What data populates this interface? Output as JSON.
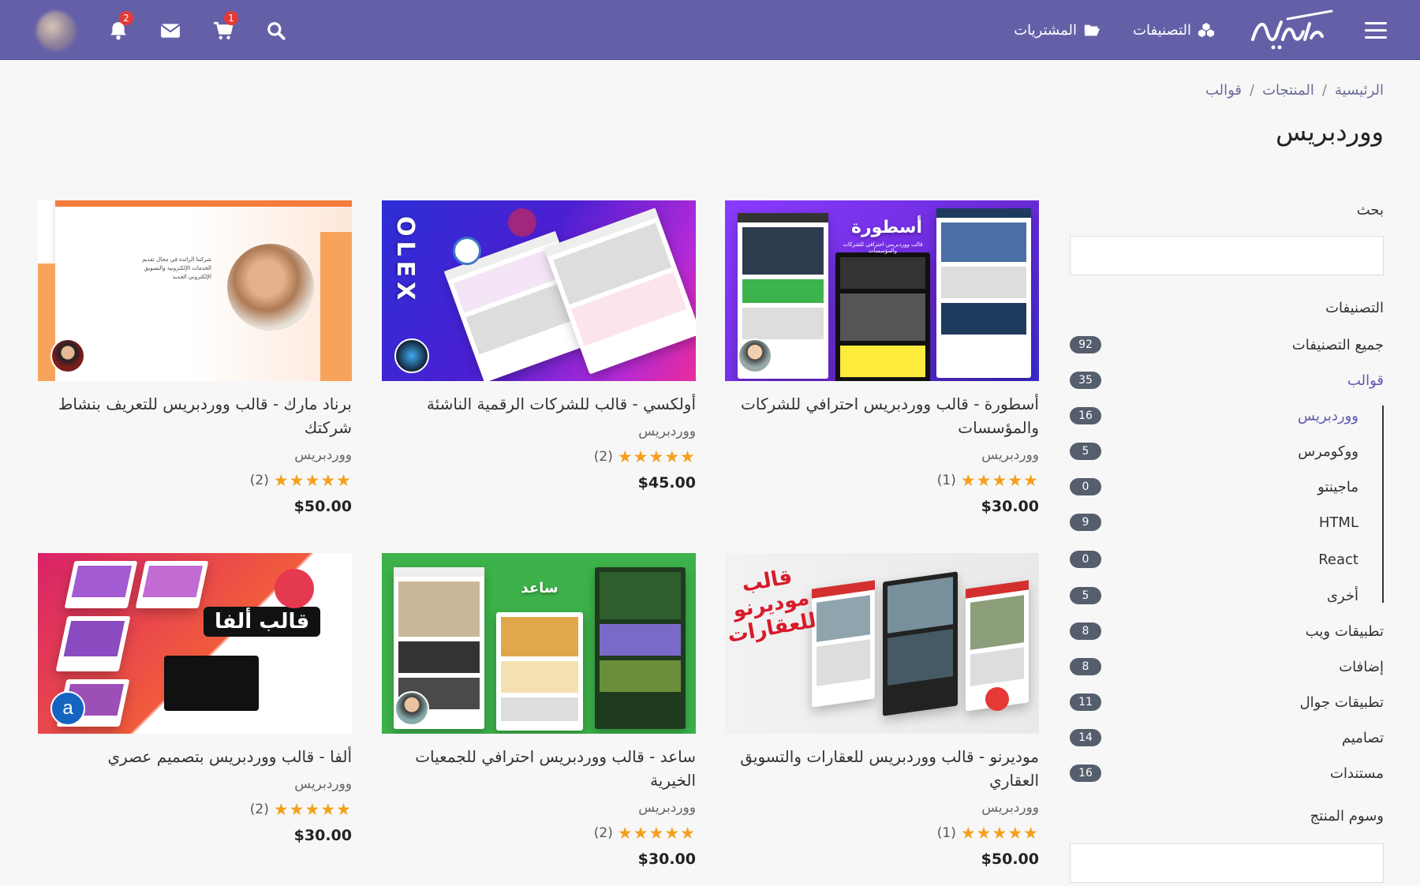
{
  "header": {
    "menu_icon": "hamburger-icon",
    "logo_icon": "brand-logo",
    "nav": [
      {
        "label": "التصنيفات",
        "icon": "cubes-icon"
      },
      {
        "label": "المشتريات",
        "icon": "folder-open-icon"
      }
    ],
    "cart_badge": "1",
    "bell_badge": "2"
  },
  "breadcrumb": [
    "الرئيسية",
    "المنتجات",
    "قوالب"
  ],
  "page_title": "ووردبريس",
  "sidebar": {
    "search_label": "بحث",
    "categories_title": "التصنيفات",
    "categories": [
      {
        "name": "جميع التصنيفات",
        "count": "92"
      },
      {
        "name": "قوالب",
        "count": "35",
        "active": true
      },
      {
        "name": "ووردبريس",
        "count": "16",
        "sub": true,
        "active": true
      },
      {
        "name": "ووكومرس",
        "count": "5",
        "sub": true
      },
      {
        "name": "ماجينتو",
        "count": "0",
        "sub": true
      },
      {
        "name": "HTML",
        "count": "9",
        "sub": true
      },
      {
        "name": "React",
        "count": "0",
        "sub": true
      },
      {
        "name": "أخرى",
        "count": "5",
        "sub": true
      },
      {
        "name": "تطبيقات ويب",
        "count": "8"
      },
      {
        "name": "إضافات",
        "count": "8"
      },
      {
        "name": "تطبيقات جوال",
        "count": "11"
      },
      {
        "name": "تصاميم",
        "count": "14"
      },
      {
        "name": "مستندات",
        "count": "16"
      }
    ],
    "tags_title": "وسوم المنتج"
  },
  "products": [
    {
      "name": "أسطورة - قالب ووردبريس احترافي للشركات والمؤسسات",
      "category": "ووردبريس",
      "rating": "(1)",
      "price": "$30.00",
      "image_text": "أسطورة",
      "image_sub": "قالب ووردبريس احترافي للشركات والمؤسسات"
    },
    {
      "name": "أولكسي - قالب للشركات الرقمية الناشئة",
      "category": "ووردبريس",
      "rating": "(2)",
      "price": "$45.00",
      "image_text": "OLEX"
    },
    {
      "name": "برناد مارك - قالب ووردبريس للتعريف بنشاط شركتك",
      "category": "ووردبريس",
      "rating": "(2)",
      "price": "$50.00",
      "image_text": "شركتنا الرائدة في مجال تقديم الخدمات الإلكترونية والتسويق الإلكتروني الجديد"
    },
    {
      "name": "موديرنو - قالب ووردبريس للعقارات والتسويق العقاري",
      "category": "ووردبريس",
      "rating": "(1)",
      "price": "$50.00",
      "image_text": "قالب موديرنو للعقارات"
    },
    {
      "name": "ساعد - قالب ووردبريس احترافي للجمعيات الخيرية",
      "category": "ووردبريس",
      "rating": "(2)",
      "price": "$30.00",
      "image_text": "ساعد"
    },
    {
      "name": "ألفا - قالب ووردبريس بتصميم عصري",
      "category": "ووردبريس",
      "rating": "(2)",
      "price": "$30.00",
      "image_text": "قالب ألفا",
      "image_avatar": "a"
    }
  ],
  "stars": "★★★★★",
  "colors": {
    "header": "#6460a8",
    "accent": "#5f5ab0",
    "star": "#f4a01c",
    "badge": "#e53935"
  }
}
